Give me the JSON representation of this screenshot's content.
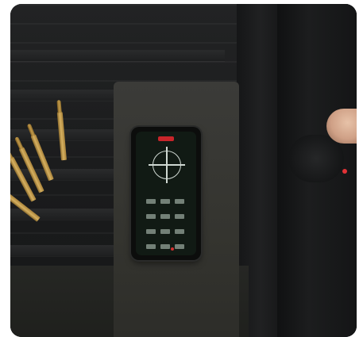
{
  "image": {
    "description_icons": [
      "phone-app-crosshair-icon",
      "ammo-cartridge",
      "tactical-bag"
    ],
    "colors": {
      "accent_red": "#c8252a",
      "brass": "#d6b060",
      "fabric": "#1b1c1d"
    }
  }
}
